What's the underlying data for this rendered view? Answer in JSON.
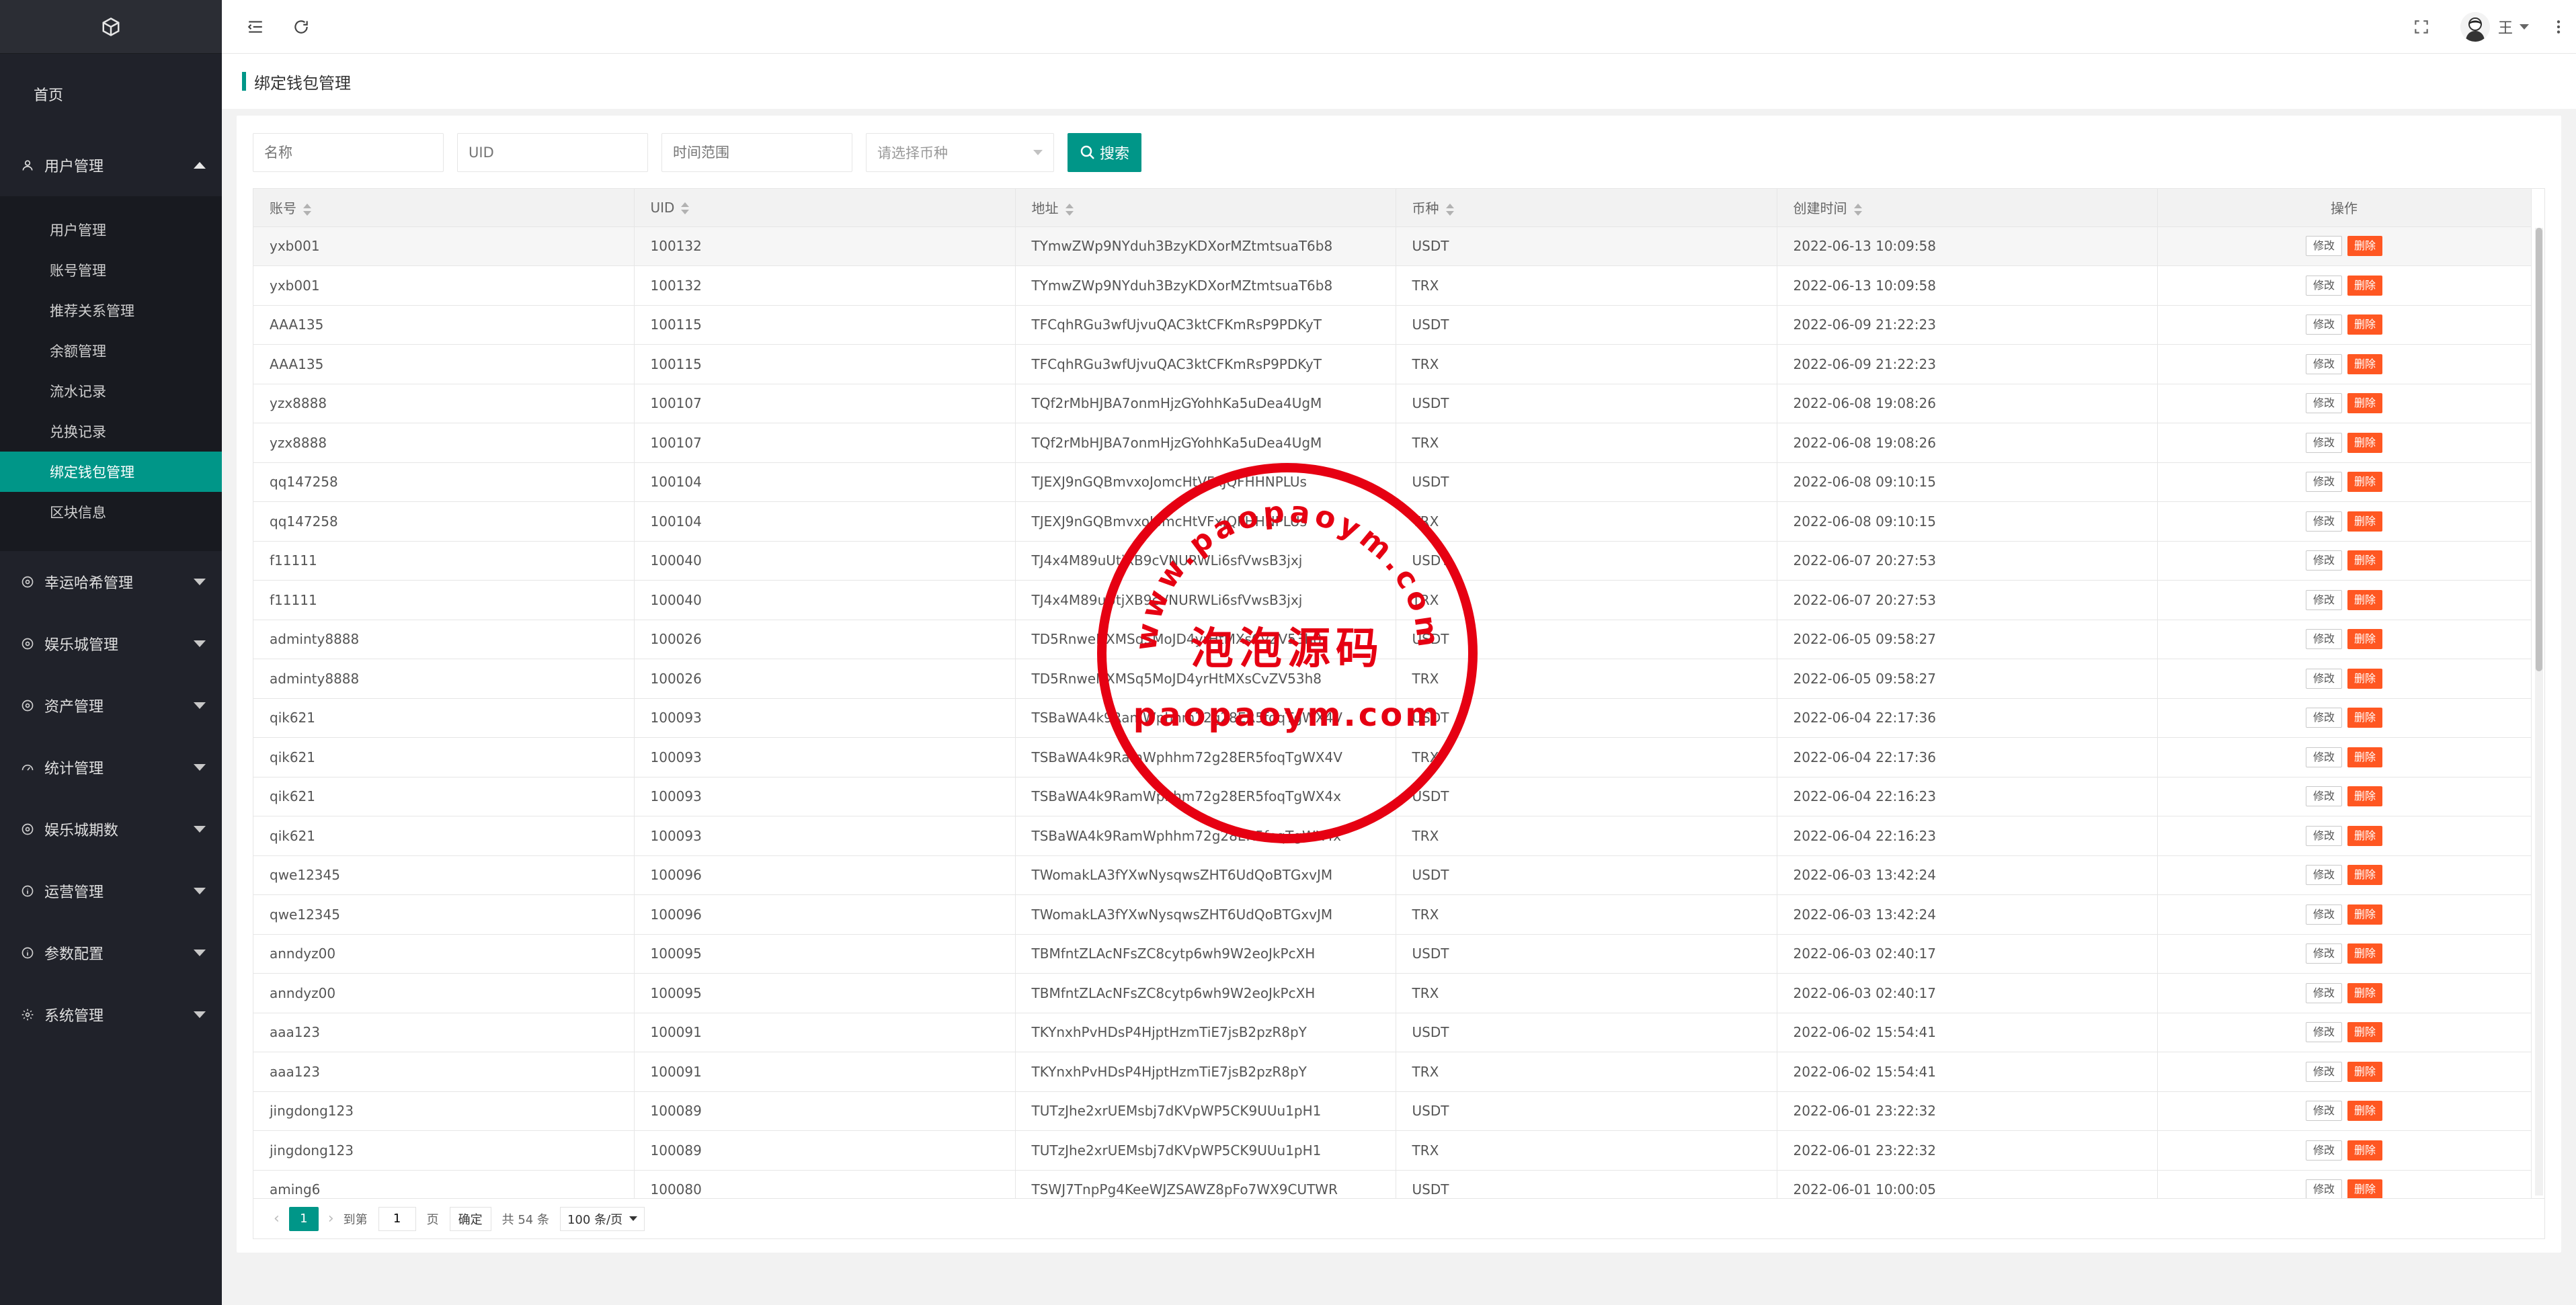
{
  "sidebar": {
    "home": "首页",
    "groups": [
      {
        "label": "用户管理",
        "icon": "user-icon",
        "expanded": true
      },
      {
        "label": "幸运哈希管理",
        "icon": "circle-icon"
      },
      {
        "label": "娱乐城管理",
        "icon": "circle-icon"
      },
      {
        "label": "资产管理",
        "icon": "circle-icon"
      },
      {
        "label": "统计管理",
        "icon": "dashboard-icon"
      },
      {
        "label": "娱乐城期数",
        "icon": "circle-icon"
      },
      {
        "label": "运营管理",
        "icon": "info-icon"
      },
      {
        "label": "参数配置",
        "icon": "info-icon"
      },
      {
        "label": "系统管理",
        "icon": "gear-icon"
      }
    ],
    "sub_items": [
      "用户管理",
      "账号管理",
      "推荐关系管理",
      "余额管理",
      "流水记录",
      "兑换记录",
      "绑定钱包管理",
      "区块信息"
    ],
    "active_sub": "绑定钱包管理"
  },
  "header": {
    "user_name": "王"
  },
  "page_title": "绑定钱包管理",
  "filters": {
    "name_placeholder": "名称",
    "uid_placeholder": "UID",
    "time_placeholder": "时间范围",
    "currency_placeholder": "请选择币种",
    "search_label": "搜索"
  },
  "table": {
    "columns": [
      "账号",
      "UID",
      "地址",
      "币种",
      "创建时间",
      "操作"
    ],
    "edit_label": "修改",
    "delete_label": "删除",
    "rows": [
      [
        "yxb001",
        "100132",
        "TYmwZWp9NYduh3BzyKDXorMZtmtsuaT6b8",
        "USDT",
        "2022-06-13 10:09:58"
      ],
      [
        "yxb001",
        "100132",
        "TYmwZWp9NYduh3BzyKDXorMZtmtsuaT6b8",
        "TRX",
        "2022-06-13 10:09:58"
      ],
      [
        "AAA135",
        "100115",
        "TFCqhRGu3wfUjvuQAC3ktCFKmRsP9PDKyT",
        "USDT",
        "2022-06-09 21:22:23"
      ],
      [
        "AAA135",
        "100115",
        "TFCqhRGu3wfUjvuQAC3ktCFKmRsP9PDKyT",
        "TRX",
        "2022-06-09 21:22:23"
      ],
      [
        "yzx8888",
        "100107",
        "TQf2rMbHJBA7onmHjzGYohhKa5uDea4UgM",
        "USDT",
        "2022-06-08 19:08:26"
      ],
      [
        "yzx8888",
        "100107",
        "TQf2rMbHJBA7onmHjzGYohhKa5uDea4UgM",
        "TRX",
        "2022-06-08 19:08:26"
      ],
      [
        "qq147258",
        "100104",
        "TJEXJ9nGQBmvxoJomcHtVFxJQFHHNPLUs",
        "USDT",
        "2022-06-08 09:10:15"
      ],
      [
        "qq147258",
        "100104",
        "TJEXJ9nGQBmvxoJomcHtVFxJQFHHNPLUs",
        "TRX",
        "2022-06-08 09:10:15"
      ],
      [
        "f11111",
        "100040",
        "TJ4x4M89uUtjXB9cVNURWLi6sfVwsB3jxj",
        "USDT",
        "2022-06-07 20:27:53"
      ],
      [
        "f11111",
        "100040",
        "TJ4x4M89uUtjXB9cVNURWLi6sfVwsB3jxj",
        "TRX",
        "2022-06-07 20:27:53"
      ],
      [
        "adminty8888",
        "100026",
        "TD5RnweNXMSq5MoJD4yrHtMXsCvZV53h8",
        "USDT",
        "2022-06-05 09:58:27"
      ],
      [
        "adminty8888",
        "100026",
        "TD5RnweNXMSq5MoJD4yrHtMXsCvZV53h8",
        "TRX",
        "2022-06-05 09:58:27"
      ],
      [
        "qik621",
        "100093",
        "TSBaWA4k9RamWphhm72g28ER5foqTgWX4V",
        "USDT",
        "2022-06-04 22:17:36"
      ],
      [
        "qik621",
        "100093",
        "TSBaWA4k9RamWphhm72g28ER5foqTgWX4V",
        "TRX",
        "2022-06-04 22:17:36"
      ],
      [
        "qik621",
        "100093",
        "TSBaWA4k9RamWphhm72g28ER5foqTgWX4x",
        "USDT",
        "2022-06-04 22:16:23"
      ],
      [
        "qik621",
        "100093",
        "TSBaWA4k9RamWphhm72g28ER5foqTgWX4x",
        "TRX",
        "2022-06-04 22:16:23"
      ],
      [
        "qwe12345",
        "100096",
        "TWomakLA3fYXwNysqwsZHT6UdQoBTGxvJM",
        "USDT",
        "2022-06-03 13:42:24"
      ],
      [
        "qwe12345",
        "100096",
        "TWomakLA3fYXwNysqwsZHT6UdQoBTGxvJM",
        "TRX",
        "2022-06-03 13:42:24"
      ],
      [
        "anndyz00",
        "100095",
        "TBMfntZLAcNFsZC8cytp6wh9W2eoJkPcXH",
        "USDT",
        "2022-06-03 02:40:17"
      ],
      [
        "anndyz00",
        "100095",
        "TBMfntZLAcNFsZC8cytp6wh9W2eoJkPcXH",
        "TRX",
        "2022-06-03 02:40:17"
      ],
      [
        "aaa123",
        "100091",
        "TKYnxhPvHDsP4HjptHzmTiE7jsB2pzR8pY",
        "USDT",
        "2022-06-02 15:54:41"
      ],
      [
        "aaa123",
        "100091",
        "TKYnxhPvHDsP4HjptHzmTiE7jsB2pzR8pY",
        "TRX",
        "2022-06-02 15:54:41"
      ],
      [
        "jingdong123",
        "100089",
        "TUTzJhe2xrUEMsbj7dKVpWP5CK9UUu1pH1",
        "USDT",
        "2022-06-01 23:22:32"
      ],
      [
        "jingdong123",
        "100089",
        "TUTzJhe2xrUEMsbj7dKVpWP5CK9UUu1pH1",
        "TRX",
        "2022-06-01 23:22:32"
      ],
      [
        "aming6",
        "100080",
        "TSWJ7TnpPg4KeeWJZSAWZ8pFo7WX9CUTWR",
        "USDT",
        "2022-06-01 10:00:05"
      ]
    ]
  },
  "pagination": {
    "current_page": "1",
    "goto_label": "到第",
    "page_input": "1",
    "page_unit": "页",
    "confirm_label": "确定",
    "total_label": "共 54 条",
    "page_size_label": "100 条/页"
  },
  "watermark": {
    "top_text": "www.paopaoym.com",
    "middle_text": "泡泡源码",
    "bottom_text": "paopaoym.com"
  },
  "colors": {
    "accent": "#009688",
    "danger": "#ff5722",
    "sidebar_bg": "#20222a",
    "stamp": "#e60012"
  }
}
